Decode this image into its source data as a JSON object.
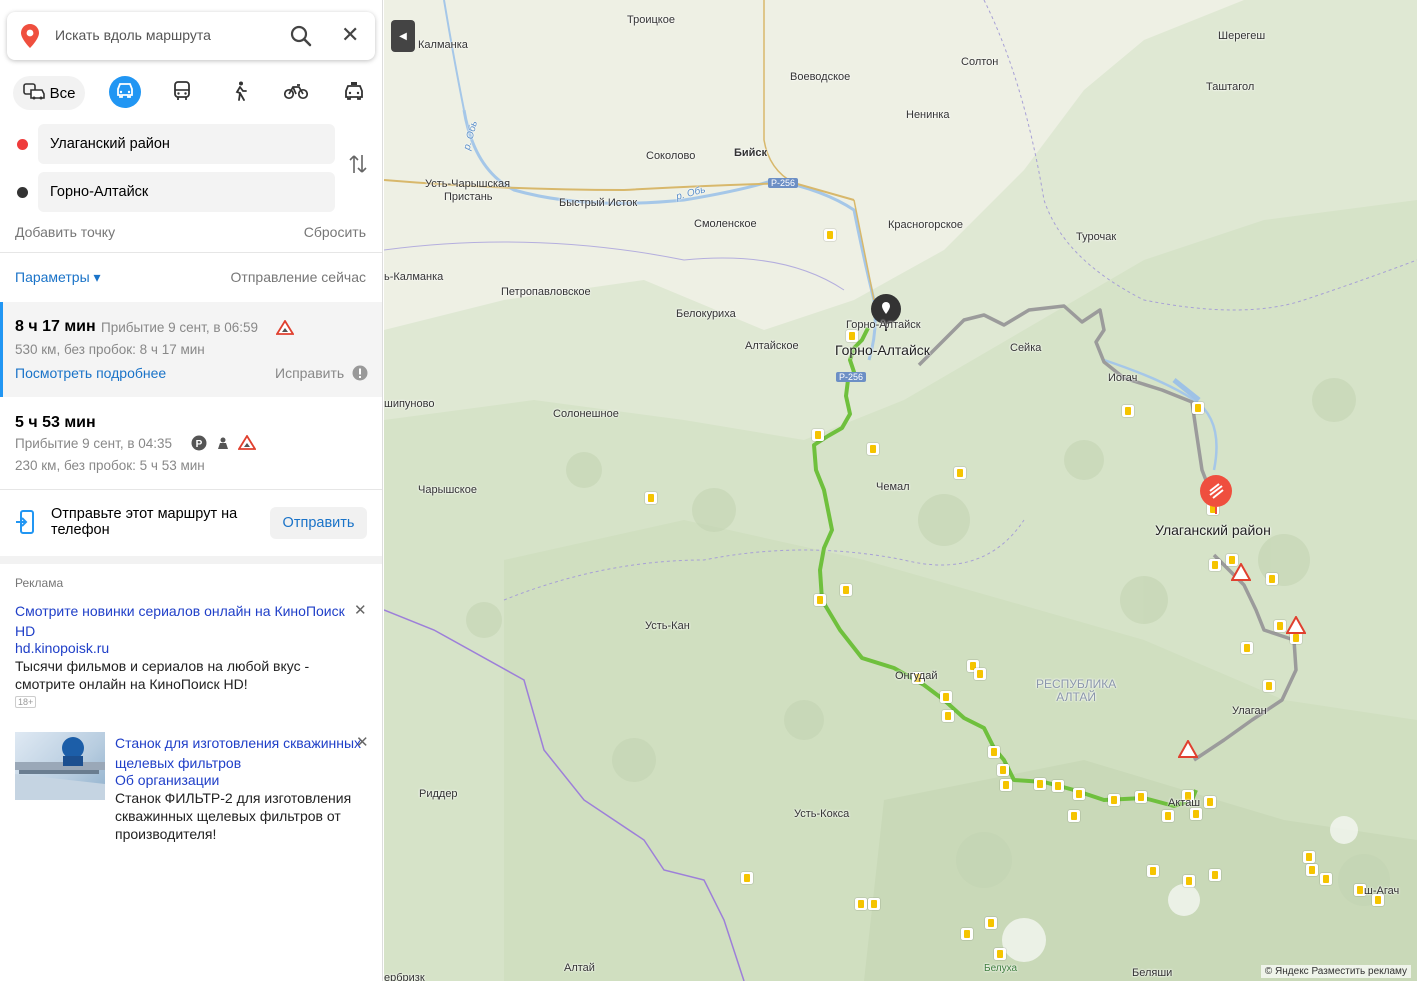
{
  "search": {
    "placeholder": "Искать вдоль маршрута"
  },
  "modes": {
    "all_label": "Все"
  },
  "points": {
    "from": "Улаганский район",
    "to": "Горно-Алтайск"
  },
  "controls": {
    "add_point": "Добавить точку",
    "reset": "Сбросить",
    "params": "Параметры ▾",
    "depart": "Отправление сейчас"
  },
  "routes": [
    {
      "time": "8 ч 17 мин",
      "arrival": "Прибытие 9 сент, в 06:59",
      "distance": "530 км, без пробок: 8 ч 17 мин",
      "details": "Посмотреть подробнее",
      "fix": "Исправить"
    },
    {
      "time": "5 ч 53 мин",
      "arrival": "Прибытие 9 сент, в 04:35",
      "distance": "230 км, без пробок: 5 ч 53 мин"
    }
  ],
  "send": {
    "text": "Отправьте этот маршрут на телефон",
    "button": "Отправить"
  },
  "ads": {
    "label": "Реклама",
    "ad1": {
      "title": "Смотрите новинки сериалов онлайн на КиноПоиск HD",
      "url": "hd.kinopoisk.ru",
      "desc": "Тысячи фильмов и сериалов на любой вкус - смотрите онлайн на КиноПоиск HD!",
      "age": "18+"
    },
    "ad2": {
      "title": "Станок для изготовления скважинных щелевых фильтров",
      "org": "Об организации",
      "desc": "Станок ФИЛЬТР-2 для изготовления скважинных щелевых фильтров от производителя!"
    }
  },
  "map": {
    "places": {
      "troitskoe": "Троицкое",
      "kalmanka": "Калманка",
      "voevodskoe": "Воеводское",
      "solton": "Солтон",
      "sheregesh": "Шерегеш",
      "tashtagol": "Таштагол",
      "neninka": "Ненинка",
      "biysk": "Бийск",
      "sokolovo": "Соколово",
      "ust_charyshskaya": "Усть-Чарышская",
      "pristan": "Пристань",
      "bystry_istok": "Быстрый Исток",
      "smolenskoe": "Смоленское",
      "krasnogorskoe": "Красногорское",
      "turochak": "Турочак",
      "ust_kalmanka": "ь-Калманка",
      "petropavlovskoe": "Петропавловское",
      "belokurikha": "Белокуриха",
      "altayskoe": "Алтайское",
      "gorno_small": "Горно-Алтайск",
      "gorno_big": "Горно-Алтайск",
      "seyka": "Сейка",
      "iogach": "Иогач",
      "shipunovo": "шипуново",
      "soloneshnoe": "Солонешное",
      "chemal": "Чемал",
      "charyshskoe": "Чарышское",
      "ulagan_big": "Улаганский район",
      "ust_kan": "Усть-Кан",
      "ongudai": "Онгудай",
      "republic": "РЕСПУБЛИКА",
      "altai_r": "АЛТАЙ",
      "ulagan": "Улаган",
      "ridder": "Риддер",
      "ust_koksa": "Усть-Кокса",
      "aktash": "Акташ",
      "kosh_agach": "ш-Агач",
      "altai": "Алтай",
      "belukha": "Белуха",
      "belyashi": "Беляши",
      "zm": "зм",
      "ob1": "р. Обь",
      "ob2": "р. Обь",
      "podgornoe": "ербризк"
    },
    "roads": {
      "r256a": "Р-256",
      "r256b": "Р-256"
    },
    "copyright": "© Яндекс   Разместить рекламу"
  },
  "colors": {
    "accent": "#2196f3",
    "route": "#6fc03d",
    "alt_route": "#9a9a9a",
    "start": "#ef4f3e"
  }
}
